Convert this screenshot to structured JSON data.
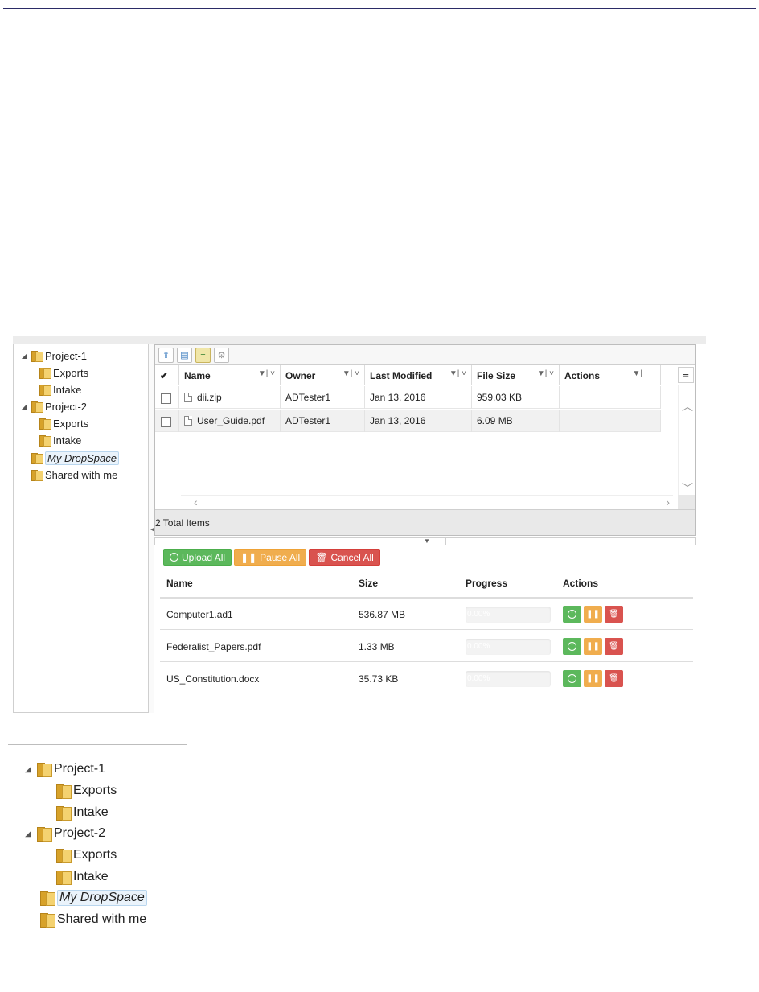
{
  "tree": {
    "items": [
      {
        "label": "Project-1",
        "expanded": true
      },
      {
        "label": "Exports"
      },
      {
        "label": "Intake"
      },
      {
        "label": "Project-2",
        "expanded": true
      },
      {
        "label": "Exports"
      },
      {
        "label": "Intake"
      },
      {
        "label": "My DropSpace",
        "selected": true
      },
      {
        "label": "Shared with me"
      }
    ]
  },
  "toolbar": {
    "icons": [
      "upload-icon",
      "database-icon",
      "add-folder-icon",
      "settings-icon"
    ]
  },
  "grid": {
    "columns": [
      "Name",
      "Owner",
      "Last Modified",
      "File Size",
      "Actions"
    ],
    "rows": [
      {
        "name": "dii.zip",
        "owner": "ADTester1",
        "modified": "Jan 13, 2016",
        "size": "959.03 KB",
        "actions": ""
      },
      {
        "name": "User_Guide.pdf",
        "owner": "ADTester1",
        "modified": "Jan 13, 2016",
        "size": "6.09 MB",
        "actions": ""
      }
    ],
    "footer": "2 Total Items"
  },
  "upload": {
    "buttons": {
      "upload_all": "Upload All",
      "pause_all": "Pause All",
      "cancel_all": "Cancel All"
    },
    "columns": [
      "Name",
      "Size",
      "Progress",
      "Actions"
    ],
    "rows": [
      {
        "name": "Computer1.ad1",
        "size": "536.87 MB",
        "progress": "0.00%",
        "progress_fraction": 0
      },
      {
        "name": "Federalist_Papers.pdf",
        "size": "1.33 MB",
        "progress": "0.00%",
        "progress_fraction": 0
      },
      {
        "name": "US_Constitution.docx",
        "size": "35.73 KB",
        "progress": "0.00%",
        "progress_fraction": 0
      }
    ]
  },
  "colors": {
    "green": "#5cb85c",
    "orange": "#f0ad4e",
    "red": "#d9534f",
    "rule": "#2b2b66"
  }
}
